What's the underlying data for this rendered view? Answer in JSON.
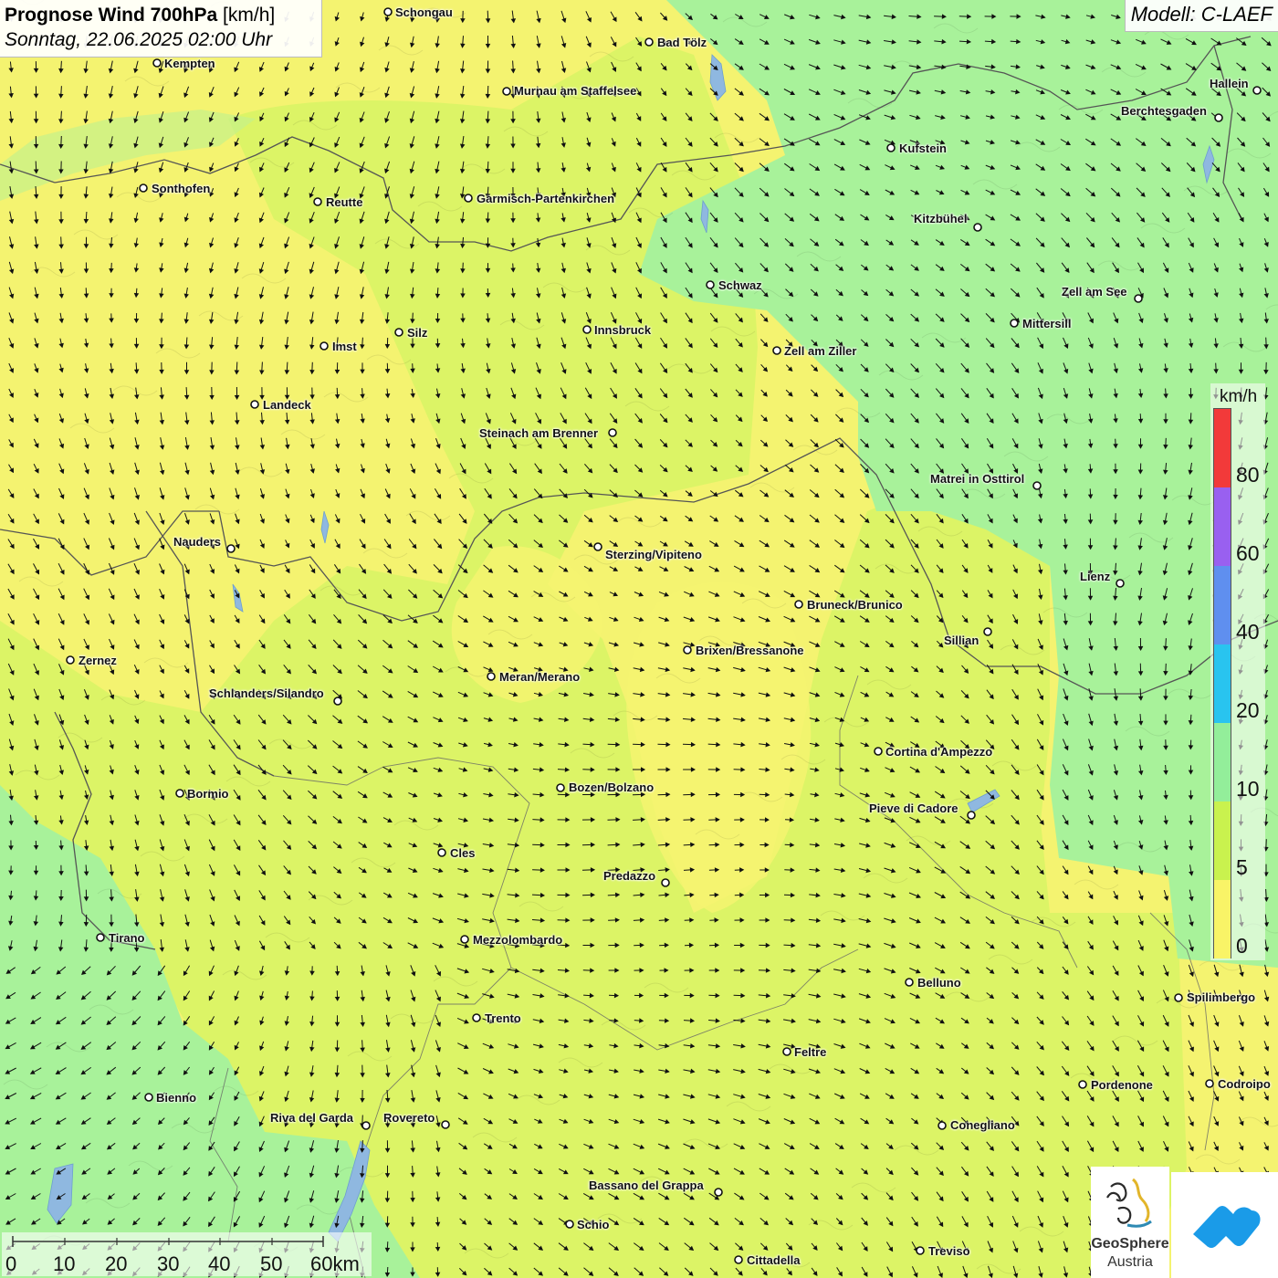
{
  "header": {
    "title_bold": "Prognose Wind 700hPa",
    "title_unit": "[km/h]",
    "datetime": "Sonntag, 22.06.2025 02:00 Uhr"
  },
  "model_label": "Modell: C-LAEF",
  "cities": [
    {
      "name": "Schongau"
    },
    {
      "name": "Bad Tölz"
    },
    {
      "name": "Kempten"
    },
    {
      "name": "Murnau am Staffelsee"
    },
    {
      "name": "Hallein"
    },
    {
      "name": "Berchtesgaden"
    },
    {
      "name": "Kufstein"
    },
    {
      "name": "Sonthofen"
    },
    {
      "name": "Reutte"
    },
    {
      "name": "Garmisch-Partenkirchen"
    },
    {
      "name": "Kitzbühel"
    },
    {
      "name": "Schwaz"
    },
    {
      "name": "Zell am See"
    },
    {
      "name": "Mittersill"
    },
    {
      "name": "Innsbruck"
    },
    {
      "name": "Silz"
    },
    {
      "name": "Imst"
    },
    {
      "name": "Zell am Ziller"
    },
    {
      "name": "Landeck"
    },
    {
      "name": "Steinach am Brenner"
    },
    {
      "name": "Matrei in Osttirol"
    },
    {
      "name": "Nauders"
    },
    {
      "name": "Sterzing/Vipiteno"
    },
    {
      "name": "Lienz"
    },
    {
      "name": "Bruneck/Brunico"
    },
    {
      "name": "Sillian"
    },
    {
      "name": "Zernez"
    },
    {
      "name": "Brixen/Bressanone"
    },
    {
      "name": "Meran/Merano"
    },
    {
      "name": "Schlanders/Silandro"
    },
    {
      "name": "Cortina d'Ampezzo"
    },
    {
      "name": "Bozen/Bolzano"
    },
    {
      "name": "Bormio"
    },
    {
      "name": "Pieve di Cadore"
    },
    {
      "name": "Cles"
    },
    {
      "name": "Predazzo"
    },
    {
      "name": "Tirano"
    },
    {
      "name": "Mezzolombardo"
    },
    {
      "name": "Belluno"
    },
    {
      "name": "Spilimbergo"
    },
    {
      "name": "Trento"
    },
    {
      "name": "Feltre"
    },
    {
      "name": "Bienno"
    },
    {
      "name": "Pordenone"
    },
    {
      "name": "Codroipo"
    },
    {
      "name": "Riva del Garda"
    },
    {
      "name": "Rovereto"
    },
    {
      "name": "Conegliano"
    },
    {
      "name": "Bassano del Grappa"
    },
    {
      "name": "Schio"
    },
    {
      "name": "Treviso"
    },
    {
      "name": "Cittadella"
    }
  ],
  "legend": {
    "unit": "km/h",
    "labels": [
      "80",
      "60",
      "40",
      "20",
      "10",
      "5",
      "0"
    ],
    "colors": [
      "#f23a3a",
      "#9960f0",
      "#5f8fef",
      "#29c4ef",
      "#93ee9a",
      "#c9f24e",
      "#f9f467"
    ]
  },
  "scalebar": {
    "labels": [
      "0",
      "10",
      "20",
      "30",
      "40",
      "50",
      "60km"
    ]
  },
  "logos": {
    "geosphere_line1": "GeoSphere",
    "geosphere_line2": "Austria"
  },
  "colors": {
    "yellow_zone": "#f4f370",
    "yellow_green_zone": "#dcf466",
    "green_zone": "#a8f29a",
    "border_line": "#555555",
    "water": "#8fb8e0"
  }
}
